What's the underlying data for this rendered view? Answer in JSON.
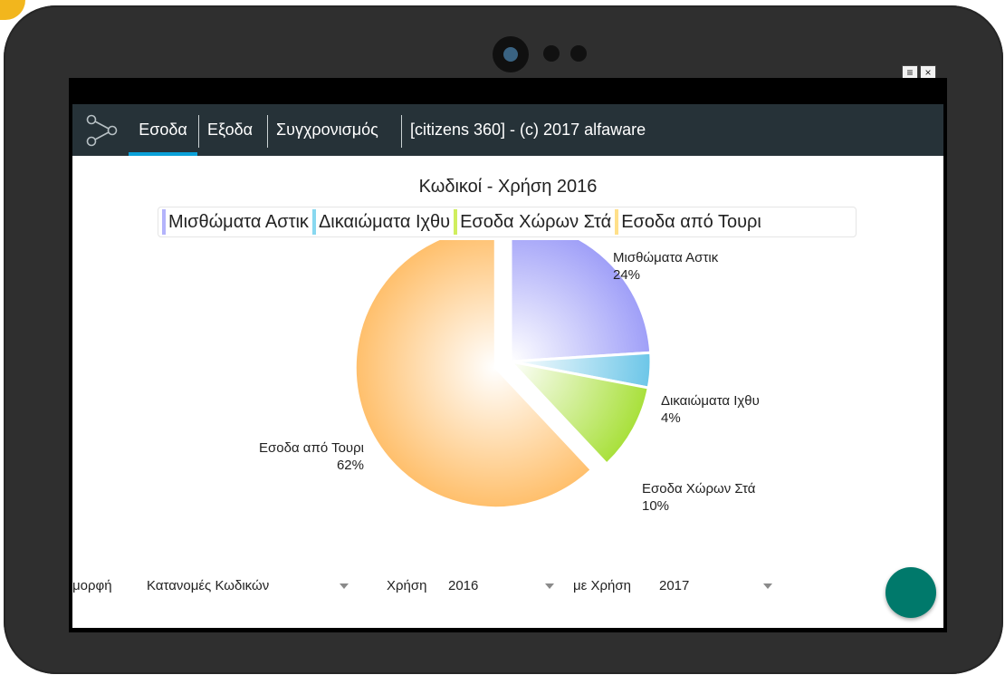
{
  "window_controls": {
    "menu_icon": "≡",
    "close_icon": "×"
  },
  "nav": {
    "logo_icon": "share-nodes-icon",
    "tabs": [
      {
        "label": "Εσοδα",
        "active": true
      },
      {
        "label": "Εξοδα",
        "active": false
      },
      {
        "label": "Συγχρονισμός",
        "active": false
      },
      {
        "label": "[citizens 360] - (c) 2017 alfaware",
        "active": false
      }
    ]
  },
  "chart_data": {
    "type": "pie",
    "title": "Κωδικοί - Χρήση 2016",
    "legend_position": "top",
    "slices": [
      {
        "label": "Μισθώματα Αστικ",
        "value": 24,
        "pct_label": "24%",
        "color": "#9f9ff8",
        "exploded": false
      },
      {
        "label": "Δικαιώματα Ιχθυ",
        "value": 4,
        "pct_label": "4%",
        "color": "#6cc6e8",
        "exploded": false
      },
      {
        "label": "Εσοδα Χώρων Στά",
        "value": 10,
        "pct_label": "10%",
        "color": "#a8e03a",
        "exploded": false
      },
      {
        "label": "Εσοδα από Τουρι",
        "value": 62,
        "pct_label": "62%",
        "color": "#ffbf6b",
        "exploded": true
      }
    ],
    "legend_colors": [
      "#b3b3fb",
      "#88d8f0",
      "#d0ee5e",
      "#ffe08a"
    ]
  },
  "controls": {
    "format_label": "μορφή",
    "format_value": "Κατανομές Κωδικών",
    "year_label": "Χρήση",
    "year_value": "2016",
    "compare_label": "με Χρήση",
    "compare_value": "2017"
  },
  "fab": {
    "color": "#00796b"
  }
}
